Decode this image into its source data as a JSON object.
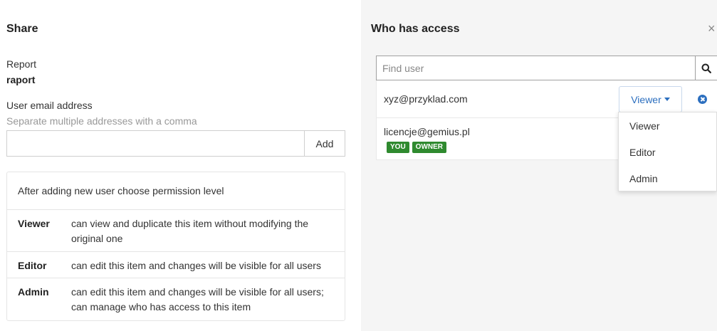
{
  "left": {
    "title": "Share",
    "report_label": "Report",
    "report_name": "raport",
    "email_label": "User email address",
    "email_help": "Separate multiple addresses with a comma",
    "email_value": "",
    "add_label": "Add",
    "permissions_header": "After adding new user choose permission level",
    "permissions": [
      {
        "name": "Viewer",
        "desc": "can view and duplicate this item without modifying the original one"
      },
      {
        "name": "Editor",
        "desc": "can edit this item and changes will be visible for all users"
      },
      {
        "name": "Admin",
        "desc": "can edit this item and changes will be visible for all users; can manage who has access to this item"
      }
    ]
  },
  "right": {
    "title": "Who has access",
    "close_icon": "×",
    "search_placeholder": "Find user",
    "users": [
      {
        "email": "xyz@przyklad.com",
        "role": "Viewer"
      },
      {
        "email": "licencje@gemius.pl",
        "badges": [
          "YOU",
          "OWNER"
        ]
      }
    ],
    "role_options": [
      "Viewer",
      "Editor",
      "Admin"
    ]
  },
  "colors": {
    "accent": "#2c6fbf",
    "badge_green": "#2f8a2f",
    "panel_bg": "#f5f5f5"
  }
}
